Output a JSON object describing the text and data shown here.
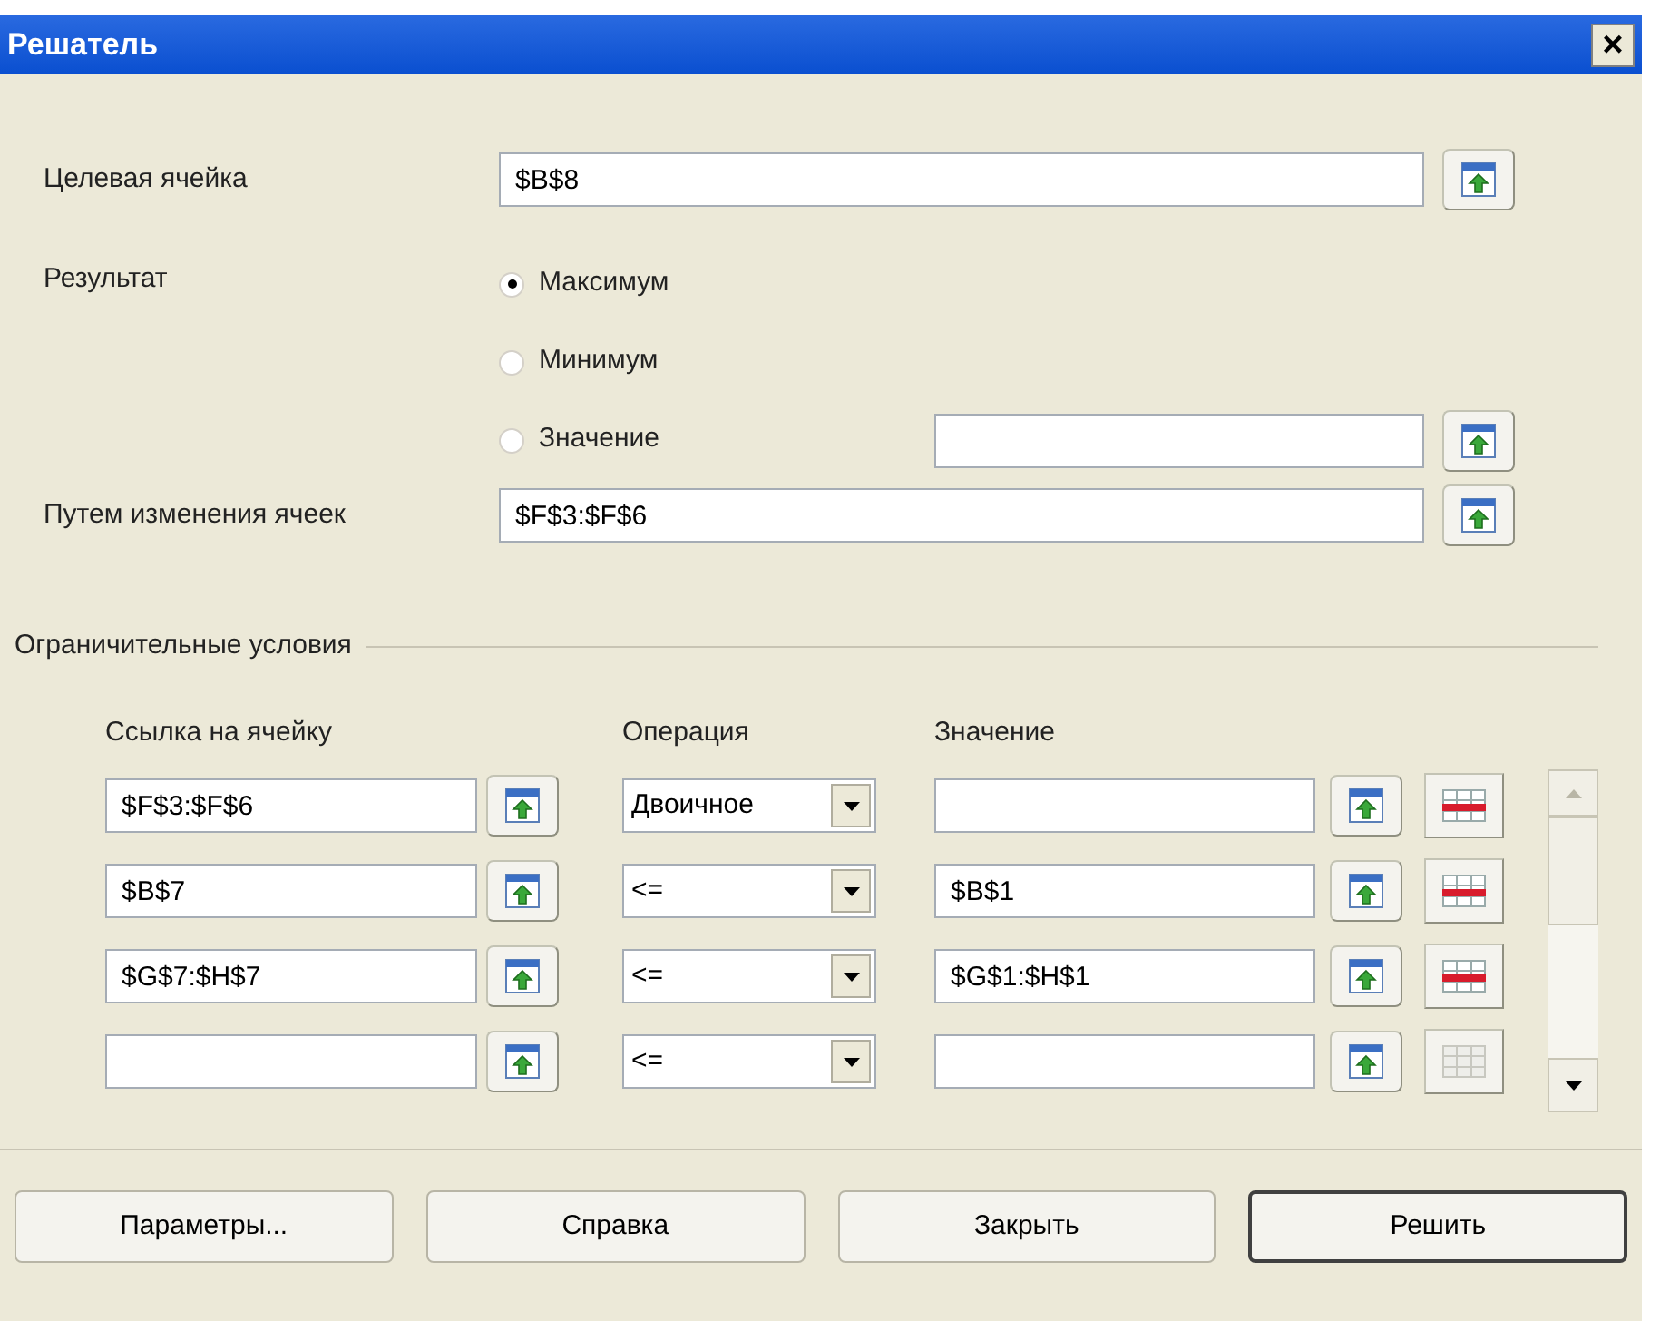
{
  "window": {
    "title": "Решатель",
    "close": "×"
  },
  "target": {
    "label": "Целевая ячейка",
    "value": "$B$8"
  },
  "result": {
    "label": "Результат",
    "options": [
      {
        "label": "Максимум",
        "selected": true,
        "field": false
      },
      {
        "label": "Минимум",
        "selected": false,
        "field": false
      },
      {
        "label": "Значение",
        "selected": false,
        "field": true
      }
    ]
  },
  "changing": {
    "label": "Путем изменения ячеек",
    "value": "$F$3:$F$6"
  },
  "constraints": {
    "title": "Ограничительные условия",
    "columns": [
      "Ссылка на ячейку",
      "Операция",
      "Значение"
    ],
    "rows": [
      {
        "cell": "$F$3:$F$6",
        "operation": "Двоичное",
        "value": "",
        "delete_disabled": false
      },
      {
        "cell": "$B$7",
        "operation": "<=",
        "value": "$B$1",
        "delete_disabled": false
      },
      {
        "cell": "$G$7:$H$7",
        "operation": "<=",
        "value": "$G$1:$H$1",
        "delete_disabled": false
      },
      {
        "cell": "",
        "operation": "<=",
        "value": "",
        "delete_disabled": true
      }
    ]
  },
  "buttons": [
    {
      "label": "Параметры...",
      "default": false
    },
    {
      "label": "Справка",
      "default": false
    },
    {
      "label": "Закрыть",
      "default": false
    },
    {
      "label": "Решить",
      "default": true
    }
  ]
}
